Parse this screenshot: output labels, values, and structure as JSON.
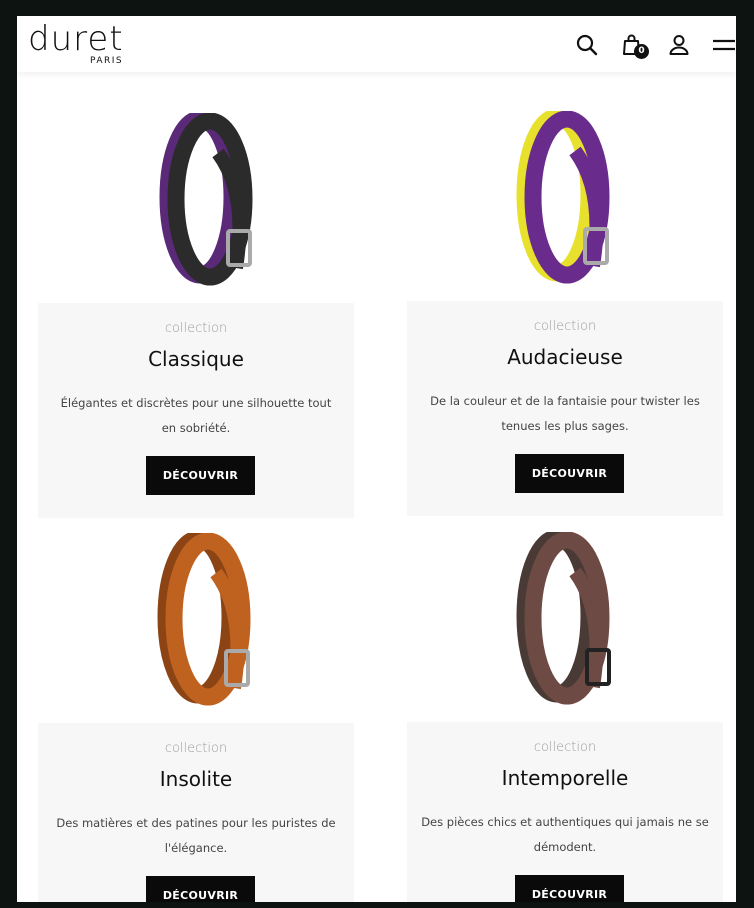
{
  "brand": {
    "name": "duret",
    "sub": "PARIS"
  },
  "header": {
    "cart_count": "0"
  },
  "cards": [
    {
      "label": "collection",
      "title": "Classique",
      "description": "Élégantes et discrètes pour une silhouette tout en sobriété.",
      "button": "DÉCOUVRIR",
      "colors": {
        "outside": "#2b2b2b",
        "inside": "#5a2a78"
      }
    },
    {
      "label": "collection",
      "title": "Audacieuse",
      "description": "De la couleur et de la fantaisie pour twister les tenues les plus sages.",
      "button": "DÉCOUVRIR",
      "colors": {
        "outside": "#6a2c8c",
        "inside": "#e7e12e"
      }
    },
    {
      "label": "collection",
      "title": "Insolite",
      "description": "Des matières et des patines pour les puristes de l'élégance.",
      "button": "DÉCOUVRIR",
      "colors": {
        "outside": "#c0621f",
        "inside": "#8d4414"
      }
    },
    {
      "label": "collection",
      "title": "Intemporelle",
      "description": "Des pièces chics et authentiques qui jamais ne se démodent.",
      "button": "DÉCOUVRIR",
      "colors": {
        "outside": "#6e4a44",
        "inside": "#4a3a36"
      }
    }
  ]
}
